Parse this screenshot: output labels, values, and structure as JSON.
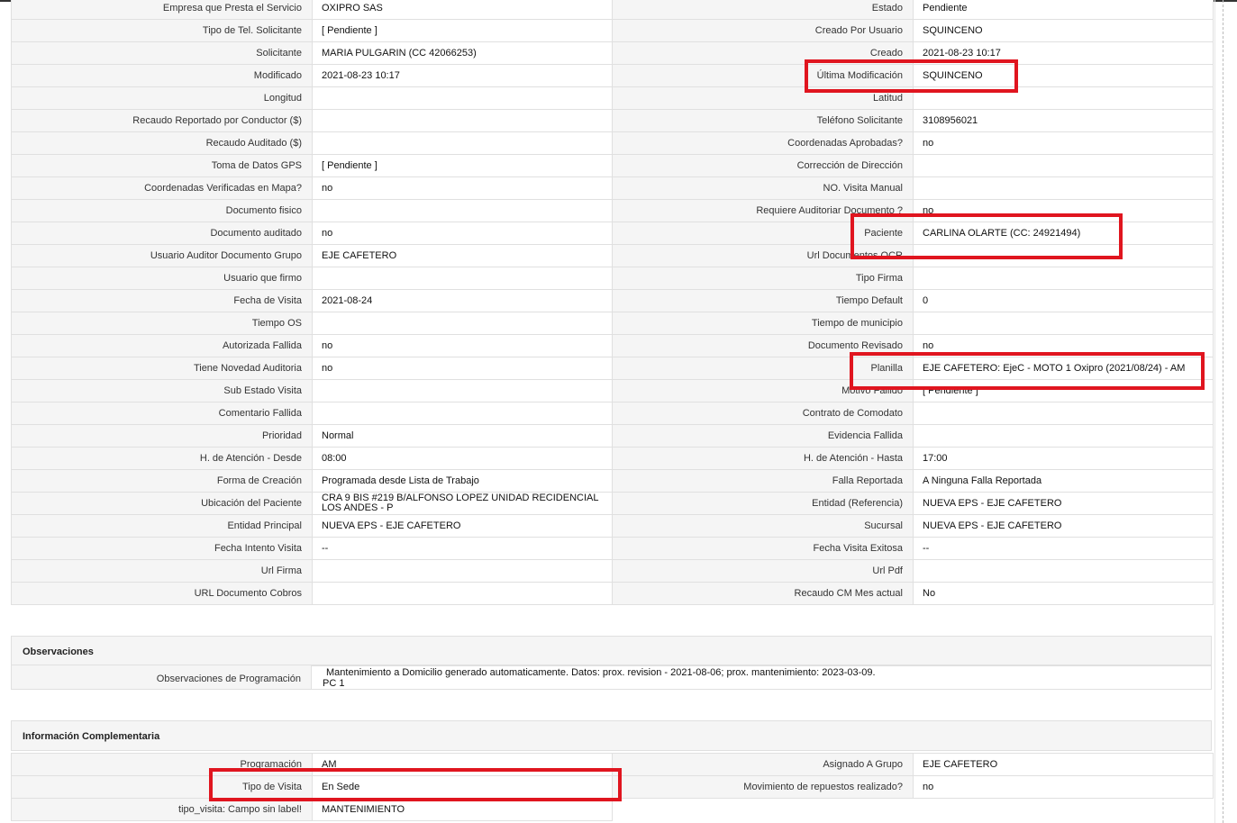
{
  "main_grid": [
    [
      "Empresa que Presta el Servicio",
      "OXIPRO SAS",
      "Estado",
      "Pendiente"
    ],
    [
      "Tipo de Tel. Solicitante",
      "[ Pendiente ]",
      "Creado Por Usuario",
      "SQUINCENO"
    ],
    [
      "Solicitante",
      "MARIA PULGARIN (CC 42066253)",
      "Creado",
      "2021-08-23 10:17"
    ],
    [
      "Modificado",
      "2021-08-23 10:17",
      "Última Modificación",
      "SQUINCENO"
    ],
    [
      "Longitud",
      "",
      "Latitud",
      ""
    ],
    [
      "Recaudo Reportado por Conductor ($)",
      "",
      "Teléfono Solicitante",
      "3108956021"
    ],
    [
      "Recaudo Auditado ($)",
      "",
      "Coordenadas Aprobadas?",
      "no"
    ],
    [
      "Toma de Datos GPS",
      "[ Pendiente ]",
      "Corrección de Dirección",
      ""
    ],
    [
      "Coordenadas Verificadas en Mapa?",
      "no",
      "NO. Visita Manual",
      ""
    ],
    [
      "Documento fisico",
      "",
      "Requiere Auditoriar Documento ?",
      "no"
    ],
    [
      "Documento auditado",
      "no",
      "Paciente",
      "CARLINA OLARTE (CC: 24921494)"
    ],
    [
      "Usuario Auditor Documento Grupo",
      "EJE CAFETERO",
      "Url Documentos OCR",
      ""
    ],
    [
      "Usuario que firmo",
      "",
      "Tipo Firma",
      ""
    ],
    [
      "Fecha de Visita",
      "2021-08-24",
      "Tiempo Default",
      "0"
    ],
    [
      "Tiempo OS",
      "",
      "Tiempo de municipio",
      ""
    ],
    [
      "Autorizada Fallida",
      "no",
      "Documento Revisado",
      "no"
    ],
    [
      "Tiene Novedad Auditoria",
      "no",
      "Planilla",
      "EJE CAFETERO: EjeC - MOTO 1 Oxipro (2021/08/24) - AM"
    ],
    [
      "Sub Estado Visita",
      "",
      "Motivo Fallido",
      "[ Pendiente ]"
    ],
    [
      "Comentario Fallida",
      "",
      "Contrato de Comodato",
      ""
    ],
    [
      "Prioridad",
      "Normal",
      "Evidencia Fallida",
      ""
    ],
    [
      "H. de Atención - Desde",
      "08:00",
      "H. de Atención - Hasta",
      "17:00"
    ],
    [
      "Forma de Creación",
      "Programada desde Lista de Trabajo",
      "Falla Reportada",
      "A Ninguna Falla Reportada"
    ],
    [
      "Ubicación del Paciente",
      "CRA 9 BIS #219 B/ALFONSO LOPEZ UNIDAD RECIDENCIAL LOS ANDES - P",
      "Entidad (Referencia)",
      "NUEVA EPS - EJE CAFETERO"
    ],
    [
      "Entidad Principal",
      "NUEVA EPS - EJE CAFETERO",
      "Sucursal",
      "NUEVA EPS - EJE CAFETERO"
    ],
    [
      "Fecha Intento Visita",
      "--",
      "Fecha Visita Exitosa",
      "--"
    ],
    [
      "Url Firma",
      "",
      "Url Pdf",
      ""
    ],
    [
      "URL Documento Cobros",
      "",
      "Recaudo CM Mes actual",
      "No"
    ]
  ],
  "observaciones": {
    "title": "Observaciones",
    "label": "Observaciones de Programación",
    "line1": "Mantenimiento a Domicilio generado automaticamente. Datos: prox. revision - 2021-08-06; prox. mantenimiento: 2023-03-09.",
    "line2": "PC 1"
  },
  "info_comp": {
    "title": "Información Complementaria",
    "rows": [
      [
        "Programación",
        "AM",
        "Asignado A Grupo",
        "EJE CAFETERO"
      ],
      [
        "Tipo de Visita",
        "En Sede",
        "Movimiento de repuestos realizado?",
        "no"
      ],
      [
        "tipo_visita: Campo sin label!",
        "MANTENIMIENTO",
        "",
        ""
      ]
    ]
  },
  "colors": {
    "highlight": "#e0151f",
    "label_bg": "#f5f5f5",
    "border": "#e0e0e0"
  }
}
